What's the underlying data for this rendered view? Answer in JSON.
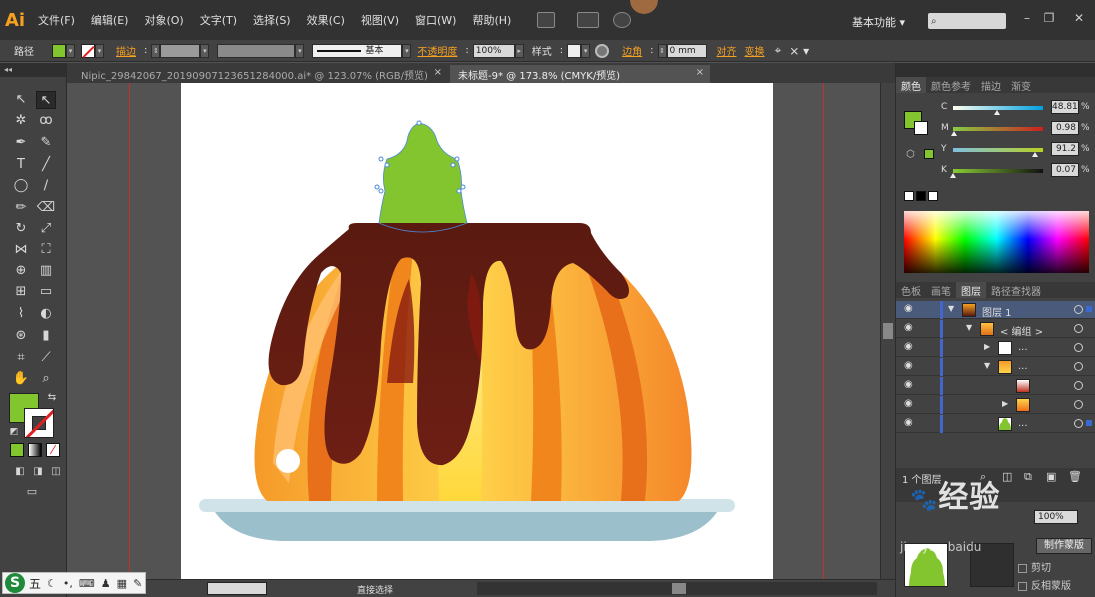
{
  "app": {
    "logo": "Ai",
    "workspace": "基本功能"
  },
  "menu": [
    "文件(F)",
    "编辑(E)",
    "对象(O)",
    "文字(T)",
    "选择(S)",
    "效果(C)",
    "视图(V)",
    "窗口(W)",
    "帮助(H)"
  ],
  "control_bar": {
    "selection_label": "路径",
    "stroke_link": "描边",
    "stroke_style": "基本",
    "opacity_link": "不透明度",
    "opacity_value": "100%",
    "style_label": "样式",
    "corner_link": "边角",
    "corner_value": "0 mm",
    "align_link": "对齐",
    "transform_link": "变换"
  },
  "tabs": [
    {
      "label": "Nipic_29842067_20190907123651284000.ai* @ 123.07% (RGB/预览)",
      "close": "×"
    },
    {
      "label": "未标题-9* @ 173.8% (CMYK/预览)",
      "close": "×"
    }
  ],
  "status": {
    "tool": "直接选择"
  },
  "panels": {
    "color_tabs": [
      "颜色",
      "颜色参考",
      "描边",
      "渐变"
    ],
    "color_sliders": [
      {
        "label": "C",
        "value": "48.81",
        "position": 0.49,
        "gradient": "linear-gradient(to right,#fffff0,#00a0e0)"
      },
      {
        "label": "M",
        "value": "0.98",
        "position": 0.01,
        "gradient": "linear-gradient(to right,#88cc44,#cc2020)"
      },
      {
        "label": "Y",
        "value": "91.2",
        "position": 0.91,
        "gradient": "linear-gradient(to right,#80c0e0,#b8d020)"
      },
      {
        "label": "K",
        "value": "0.07",
        "position": 0.0,
        "gradient": "linear-gradient(to right,#88cc33,#111)"
      }
    ],
    "layers_tabs": [
      "色板",
      "画笔",
      "图层",
      "路径查找器"
    ],
    "layers": [
      {
        "name": "图层 1",
        "indent": 0,
        "arrow": "▼",
        "selected": true
      },
      {
        "name": "< 编组 >",
        "indent": 1,
        "arrow": "▼",
        "selected": false
      },
      {
        "name": "...",
        "indent": 2,
        "arrow": "▶",
        "selected": false
      },
      {
        "name": "...",
        "indent": 2,
        "arrow": "▼",
        "selected": false
      },
      {
        "name": "",
        "indent": 3,
        "arrow": "",
        "selected": false
      },
      {
        "name": "",
        "indent": 3,
        "arrow": "▶",
        "selected": false
      },
      {
        "name": "...",
        "indent": 2,
        "arrow": "",
        "selected": false
      }
    ],
    "layers_count": "1 个图层",
    "transparency": {
      "opacity": "100%",
      "mask_button": "制作蒙版",
      "clip": "剪切",
      "invert": "反相蒙版"
    }
  },
  "ime": {
    "logo": "S",
    "mode": "五"
  },
  "colors": {
    "fill": "#82c52e",
    "accent": "#f7a020",
    "bleed": "#c23030"
  },
  "watermark": {
    "text": "经验",
    "sub": "jingyan.baidu"
  }
}
